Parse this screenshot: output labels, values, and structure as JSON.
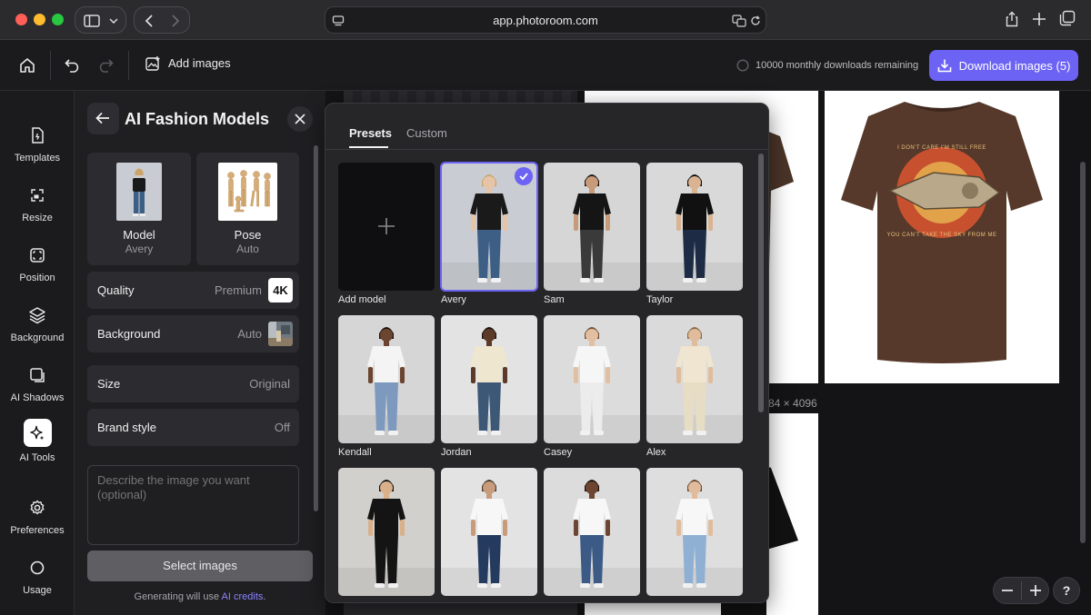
{
  "browser": {
    "url": "app.photoroom.com"
  },
  "appbar": {
    "add_images_label": "Add images",
    "downloads_remaining": "10000 monthly downloads remaining",
    "download_label": "Download images (5)",
    "accent_color": "#6c63f5"
  },
  "rail": {
    "items": [
      {
        "label": "Templates",
        "icon": "templates-icon"
      },
      {
        "label": "Resize",
        "icon": "resize-icon"
      },
      {
        "label": "Position",
        "icon": "position-icon"
      },
      {
        "label": "Background",
        "icon": "layers-icon"
      },
      {
        "label": "AI Shadows",
        "icon": "shadow-icon"
      },
      {
        "label": "AI Tools",
        "icon": "sparkle-icon"
      },
      {
        "label": "Preferences",
        "icon": "gear-icon"
      },
      {
        "label": "Usage",
        "icon": "usage-circle-icon"
      }
    ]
  },
  "panel": {
    "title": "AI Fashion Models",
    "model": {
      "label": "Model",
      "value": "Avery"
    },
    "pose": {
      "label": "Pose",
      "value": "Auto"
    },
    "quality": {
      "label": "Quality",
      "value": "Premium",
      "badge": "4K"
    },
    "background": {
      "label": "Background",
      "value": "Auto"
    },
    "size": {
      "label": "Size",
      "value": "Original"
    },
    "brand_style": {
      "label": "Brand style",
      "value": "Off"
    },
    "prompt_placeholder": "Describe the image you want (optional)",
    "select_button": "Select images",
    "footer_prefix": "Generating will use ",
    "footer_link": "AI credits",
    "footer_suffix": "."
  },
  "canvas": {
    "dimension_label": "84 × 4096",
    "shirt_print_line1": "I DON'T CARE I'M STILL FREE",
    "shirt_print_line2": "YOU CAN'T TAKE THE SKY FROM ME"
  },
  "popup": {
    "tabs": [
      "Presets",
      "Custom"
    ],
    "active_tab": "Presets",
    "add_model_label": "Add model",
    "models": [
      {
        "name": "Avery",
        "selected": true,
        "top": "#1a1a1a",
        "bottom": "#3d5f86",
        "bg": "#c9ccd2",
        "skin": "#e6c4a8",
        "hair": "#c9a56b"
      },
      {
        "name": "Sam",
        "selected": false,
        "top": "#151515",
        "bottom": "#3a3a3a",
        "bg": "#d6d6d6",
        "skin": "#c79a7a",
        "hair": "#1c1410"
      },
      {
        "name": "Taylor",
        "selected": false,
        "top": "#111111",
        "bottom": "#1d2b45",
        "bg": "#d9d9d9",
        "skin": "#d9b392",
        "hair": "#111111"
      },
      {
        "name": "Kendall",
        "selected": false,
        "top": "#f4f4f4",
        "bottom": "#7d99bd",
        "bg": "#d6d6d6",
        "skin": "#6b4530",
        "hair": "#1a120d"
      },
      {
        "name": "Jordan",
        "selected": false,
        "top": "#efe6cf",
        "bottom": "#3d5877",
        "bg": "#e3e3e3",
        "skin": "#5b3a28",
        "hair": "#1a120d"
      },
      {
        "name": "Casey",
        "selected": false,
        "top": "#f6f6f6",
        "bottom": "#ececec",
        "bg": "#dcdcdc",
        "skin": "#e2bfa0",
        "hair": "#6e4f34"
      },
      {
        "name": "Alex",
        "selected": false,
        "top": "#efe5d0",
        "bottom": "#e7dcc4",
        "bg": "#dadada",
        "skin": "#e0bc9c",
        "hair": "#8a6a48"
      },
      {
        "name": "",
        "selected": false,
        "top": "#141414",
        "bottom": "#141414",
        "bg": "#d2d0cc",
        "skin": "#d9b08a",
        "hair": "#111111"
      },
      {
        "name": "",
        "selected": false,
        "top": "#f7f7f7",
        "bottom": "#243a5e",
        "bg": "#e3e3e3",
        "skin": "#c89b7b",
        "hair": "#4a3a2e"
      },
      {
        "name": "",
        "selected": false,
        "top": "#f7f7f7",
        "bottom": "#3c5a86",
        "bg": "#dcdcdc",
        "skin": "#6e4530",
        "hair": "#1a120d"
      },
      {
        "name": "",
        "selected": false,
        "top": "#f7f7f7",
        "bottom": "#8fb0d3",
        "bg": "#dedede",
        "skin": "#e0bc9c",
        "hair": "#6b4a30"
      }
    ]
  }
}
